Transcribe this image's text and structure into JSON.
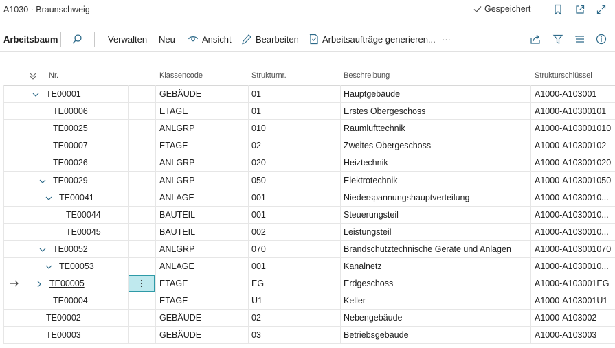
{
  "window": {
    "title": "A1030 · Braunschweig",
    "saved_status": "Gespeichert"
  },
  "actions": {
    "tree_label": "Arbeitsbaum",
    "manage": "Verwalten",
    "new": "Neu",
    "view": "Ansicht",
    "edit": "Bearbeiten",
    "generate": "Arbeitsaufträge generieren...",
    "more": "···"
  },
  "columns": {
    "nr": "Nr.",
    "class_code": "Klassencode",
    "struct_no": "Strukturnr.",
    "description": "Beschreibung",
    "struct_key": "Strukturschlüssel"
  },
  "rows": [
    {
      "nr": "TE00001",
      "class": "GEBÄUDE",
      "struct": "01",
      "desc": "Hauptgebäude",
      "key": "A1000-A103001",
      "level": 0,
      "toggle": "down"
    },
    {
      "nr": "TE00006",
      "class": "ETAGE",
      "struct": "01",
      "desc": "Erstes Obergeschoss",
      "key": "A1000-A10300101",
      "level": 1,
      "toggle": "none"
    },
    {
      "nr": "TE00025",
      "class": "ANLGRP",
      "struct": "010",
      "desc": "Raumlufttechnik",
      "key": "A1000-A103001010",
      "level": 1,
      "toggle": "none"
    },
    {
      "nr": "TE00007",
      "class": "ETAGE",
      "struct": "02",
      "desc": "Zweites Obergeschoss",
      "key": "A1000-A10300102",
      "level": 1,
      "toggle": "none"
    },
    {
      "nr": "TE00026",
      "class": "ANLGRP",
      "struct": "020",
      "desc": "Heiztechnik",
      "key": "A1000-A103001020",
      "level": 1,
      "toggle": "none"
    },
    {
      "nr": "TE00029",
      "class": "ANLGRP",
      "struct": "050",
      "desc": "Elektrotechnik",
      "key": "A1000-A103001050",
      "level": 1,
      "toggle": "down"
    },
    {
      "nr": "TE00041",
      "class": "ANLAGE",
      "struct": "001",
      "desc": "Niederspannungshauptverteilung",
      "key": "A1000-A1030010...",
      "level": 2,
      "toggle": "down"
    },
    {
      "nr": "TE00044",
      "class": "BAUTEIL",
      "struct": "001",
      "desc": "Steuerungsteil",
      "key": "A1000-A1030010...",
      "level": 3,
      "toggle": "none"
    },
    {
      "nr": "TE00045",
      "class": "BAUTEIL",
      "struct": "002",
      "desc": "Leistungsteil",
      "key": "A1000-A1030010...",
      "level": 3,
      "toggle": "none"
    },
    {
      "nr": "TE00052",
      "class": "ANLGRP",
      "struct": "070",
      "desc": "Brandschutztechnische Geräte und Anlagen",
      "key": "A1000-A103001070",
      "level": 1,
      "toggle": "down"
    },
    {
      "nr": "TE00053",
      "class": "ANLAGE",
      "struct": "001",
      "desc": "Kanalnetz",
      "key": "A1000-A1030010...",
      "level": 2,
      "toggle": "down"
    },
    {
      "nr": "TE00005",
      "class": "ETAGE",
      "struct": "EG",
      "desc": "Erdgeschoss",
      "key": "A1000-A103001EG",
      "level": 1,
      "toggle": "right",
      "selected": true
    },
    {
      "nr": "TE00004",
      "class": "ETAGE",
      "struct": "U1",
      "desc": "Keller",
      "key": "A1000-A103001U1",
      "level": 1,
      "toggle": "none"
    },
    {
      "nr": "TE00002",
      "class": "GEBÄUDE",
      "struct": "02",
      "desc": "Nebengebäude",
      "key": "A1000-A103002",
      "level": 0,
      "toggle": "none"
    },
    {
      "nr": "TE00003",
      "class": "GEBÄUDE",
      "struct": "03",
      "desc": "Betriebsgebäude",
      "key": "A1000-A103003",
      "level": 0,
      "toggle": "none"
    }
  ]
}
